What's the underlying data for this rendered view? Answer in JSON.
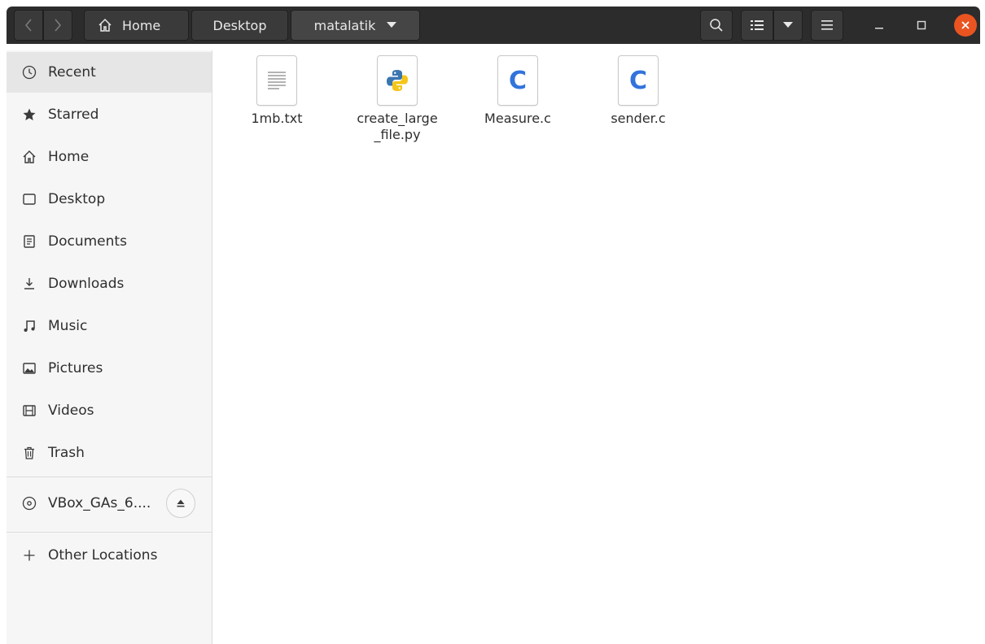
{
  "header": {
    "breadcrumbs": [
      "Home",
      "Desktop",
      "matalatik"
    ],
    "close_color": "#e95420"
  },
  "sidebar": {
    "items": [
      {
        "label": "Recent",
        "icon": "clock-icon"
      },
      {
        "label": "Starred",
        "icon": "star-icon"
      },
      {
        "label": "Home",
        "icon": "home-icon"
      },
      {
        "label": "Desktop",
        "icon": "desktop-icon"
      },
      {
        "label": "Documents",
        "icon": "document-icon"
      },
      {
        "label": "Downloads",
        "icon": "download-icon"
      },
      {
        "label": "Music",
        "icon": "music-icon"
      },
      {
        "label": "Pictures",
        "icon": "picture-icon"
      },
      {
        "label": "Videos",
        "icon": "video-icon"
      },
      {
        "label": "Trash",
        "icon": "trash-icon"
      }
    ],
    "device": {
      "label": "VBox_GAs_6....",
      "icon": "disc-icon"
    },
    "other_locations": {
      "label": "Other Locations",
      "icon": "plus-icon"
    }
  },
  "files": [
    {
      "name": "1mb.txt",
      "type": "text"
    },
    {
      "name": "create_large_file.py",
      "type": "python"
    },
    {
      "name": "Measure.c",
      "type": "c"
    },
    {
      "name": "sender.c",
      "type": "c"
    }
  ],
  "colors": {
    "c_icon": "#3273dc",
    "python_blue": "#3a76b0",
    "python_yellow": "#f5c518"
  }
}
